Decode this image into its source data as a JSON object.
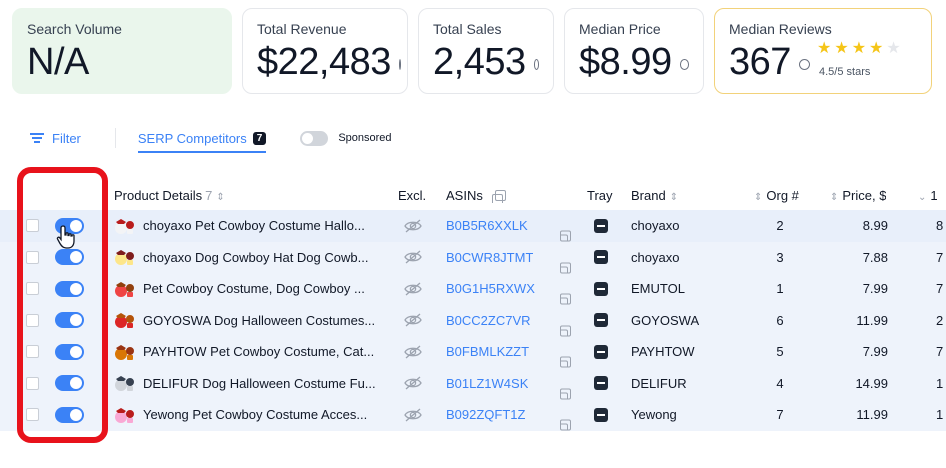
{
  "metrics": {
    "search_volume": {
      "label": "Search Volume",
      "value": "N/A"
    },
    "total_revenue": {
      "label": "Total Revenue",
      "value": "$22,483"
    },
    "total_sales": {
      "label": "Total Sales",
      "value": "2,453"
    },
    "median_price": {
      "label": "Median Price",
      "value": "$8.99"
    },
    "median_reviews": {
      "label": "Median Reviews",
      "value": "367",
      "rating": 4.5,
      "rating_text": "4.5/5 stars"
    }
  },
  "toolbar": {
    "filter_label": "Filter",
    "tab_label": "SERP Competitors",
    "tab_count": "7",
    "sponsored_label": "Sponsored",
    "sponsored_enabled": false
  },
  "table": {
    "headers": {
      "product": "Product Details",
      "product_count": "7",
      "excl": "Excl.",
      "asins": "ASINs",
      "tray": "Tray",
      "brand": "Brand",
      "org": "Org #",
      "price": "Price, $",
      "edge": "1"
    },
    "rows": [
      {
        "name": "choyaxo Pet Cowboy Costume Hallo...",
        "asin": "B0B5R6XXLK",
        "brand": "choyaxo",
        "org": "2",
        "price": "8.99",
        "edge": "8"
      },
      {
        "name": "choyaxo Dog Cowboy Hat Dog Cowb...",
        "asin": "B0CWR8JTMT",
        "brand": "choyaxo",
        "org": "3",
        "price": "7.88",
        "edge": "7"
      },
      {
        "name": "Pet Cowboy Costume, Dog Cowboy ...",
        "asin": "B0G1H5RXWX",
        "brand": "EMUTOL",
        "org": "1",
        "price": "7.99",
        "edge": "7"
      },
      {
        "name": "GOYOSWA Dog Halloween Costumes...",
        "asin": "B0CC2ZC7VR",
        "brand": "GOYOSWA",
        "org": "6",
        "price": "11.99",
        "edge": "2"
      },
      {
        "name": "PAYHTOW Pet Cowboy Costume, Cat...",
        "asin": "B0FBMLKZZT",
        "brand": "PAYHTOW",
        "org": "5",
        "price": "7.99",
        "edge": "7"
      },
      {
        "name": "DELIFUR Dog Halloween Costume Fu...",
        "asin": "B01LZ1W4SK",
        "brand": "DELIFUR",
        "org": "4",
        "price": "14.99",
        "edge": "1"
      },
      {
        "name": "Yewong Pet Cowboy Costume Acces...",
        "asin": "B092ZQFT1Z",
        "brand": "Yewong",
        "org": "7",
        "price": "11.99",
        "edge": "1"
      }
    ]
  },
  "colors": {
    "accent": "#3b82f6",
    "highlight": "#e8121b",
    "star": "#f5c518"
  }
}
